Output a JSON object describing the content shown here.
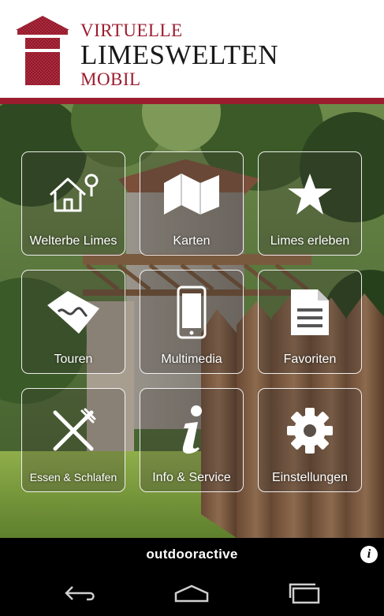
{
  "header": {
    "logo": {
      "line1": "VIRTUELLE",
      "line2": "LIMESWELTEN",
      "line3": "MOBIL",
      "icon": "tower-logo-icon"
    },
    "brand_color": "#9b1c2e"
  },
  "menu": {
    "tiles": [
      {
        "label": "Welterbe Limes",
        "icon": "house-tree-icon"
      },
      {
        "label": "Karten",
        "icon": "map-icon"
      },
      {
        "label": "Limes erleben",
        "icon": "star-icon"
      },
      {
        "label": "Touren",
        "icon": "route-map-icon"
      },
      {
        "label": "Multimedia",
        "icon": "smartphone-icon"
      },
      {
        "label": "Favoriten",
        "icon": "document-icon"
      },
      {
        "label": "Essen & Schlafen",
        "icon": "fork-knife-icon"
      },
      {
        "label": "Info & Service",
        "icon": "info-icon"
      },
      {
        "label": "Einstellungen",
        "icon": "gear-icon"
      }
    ]
  },
  "footer": {
    "brand": "outdooractive",
    "info_icon": "info-circle-icon"
  },
  "navbar": {
    "back": "back-icon",
    "home": "home-icon",
    "recents": "recents-icon"
  }
}
